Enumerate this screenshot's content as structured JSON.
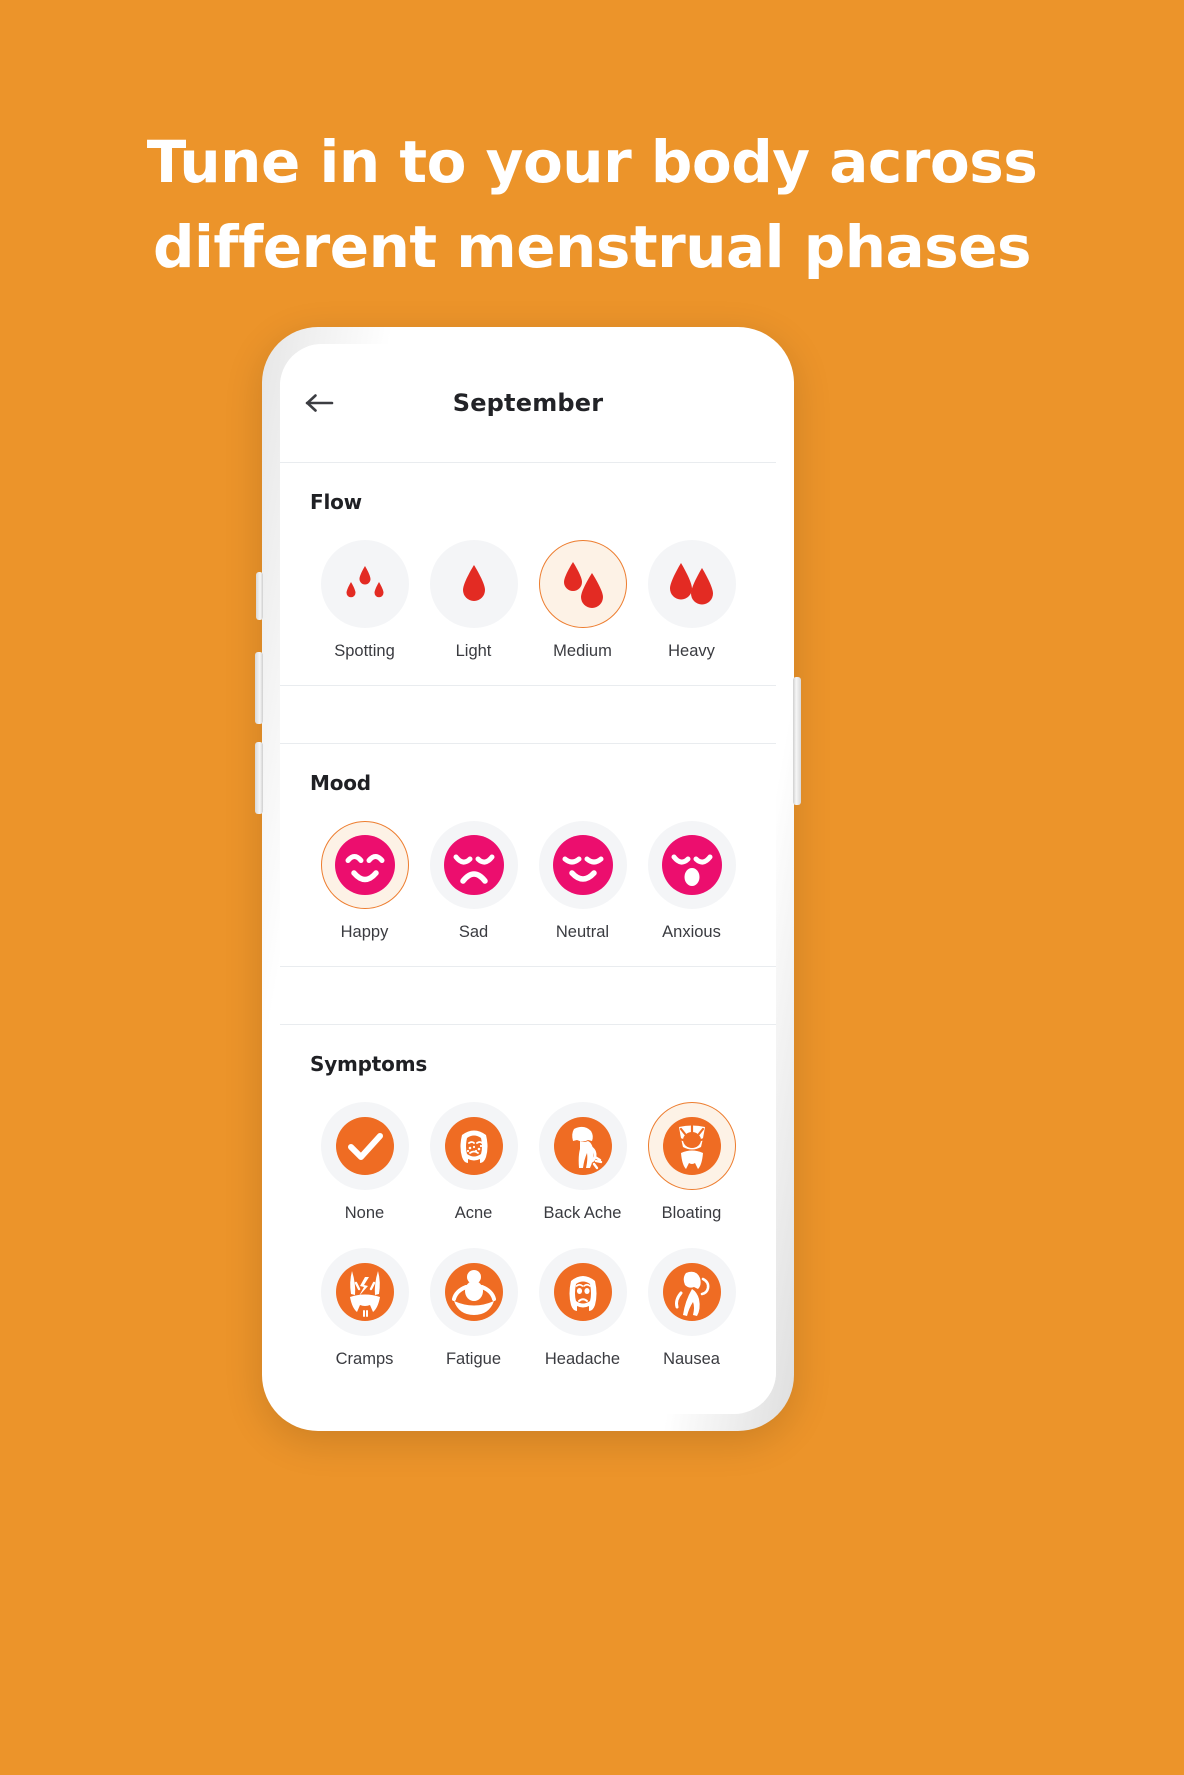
{
  "background_color": "#EC942A",
  "headline": {
    "line1": "Tune in to your body across",
    "line2": "different menstrual phases"
  },
  "phone": {
    "app": {
      "header": {
        "back_icon": "arrow-left-icon",
        "title": "September"
      },
      "sections": [
        {
          "id": "flow",
          "title": "Flow",
          "accent": "#E32B23",
          "items": [
            {
              "label": "Spotting",
              "icon": "three-small-blood-drops-icon",
              "selected": false
            },
            {
              "label": "Light",
              "icon": "one-blood-drop-icon",
              "selected": false
            },
            {
              "label": "Medium",
              "icon": "two-blood-drops-icon",
              "selected": true
            },
            {
              "label": "Heavy",
              "icon": "two-large-blood-drops-icon",
              "selected": false
            }
          ]
        },
        {
          "id": "mood",
          "title": "Mood",
          "accent": "#EC0E6E",
          "items": [
            {
              "label": "Happy",
              "icon": "happy-face-icon",
              "selected": true
            },
            {
              "label": "Sad",
              "icon": "sad-face-icon",
              "selected": false
            },
            {
              "label": "Neutral",
              "icon": "neutral-face-icon",
              "selected": false
            },
            {
              "label": "Anxious",
              "icon": "anxious-face-icon",
              "selected": false
            }
          ]
        },
        {
          "id": "symptoms",
          "title": "Symptoms",
          "accent": "#EF6C23",
          "items": [
            {
              "label": "None",
              "icon": "checkmark-icon",
              "selected": false
            },
            {
              "label": "Acne",
              "icon": "acne-face-icon",
              "selected": false
            },
            {
              "label": "Back Ache",
              "icon": "back-ache-woman-icon",
              "selected": false
            },
            {
              "label": "Bloating",
              "icon": "bloating-belly-icon",
              "selected": true
            },
            {
              "label": "Cramps",
              "icon": "cramps-torso-icon",
              "selected": false
            },
            {
              "label": "Fatigue",
              "icon": "fatigue-person-icon",
              "selected": false
            },
            {
              "label": "Headache",
              "icon": "headache-face-icon",
              "selected": false
            },
            {
              "label": "Nausea",
              "icon": "nausea-person-icon",
              "selected": false
            }
          ]
        }
      ]
    }
  },
  "selected_border_color": "#ED7D2F",
  "selected_fill_color": "#FDF2E6",
  "bubble_color": "#F4F5F7"
}
